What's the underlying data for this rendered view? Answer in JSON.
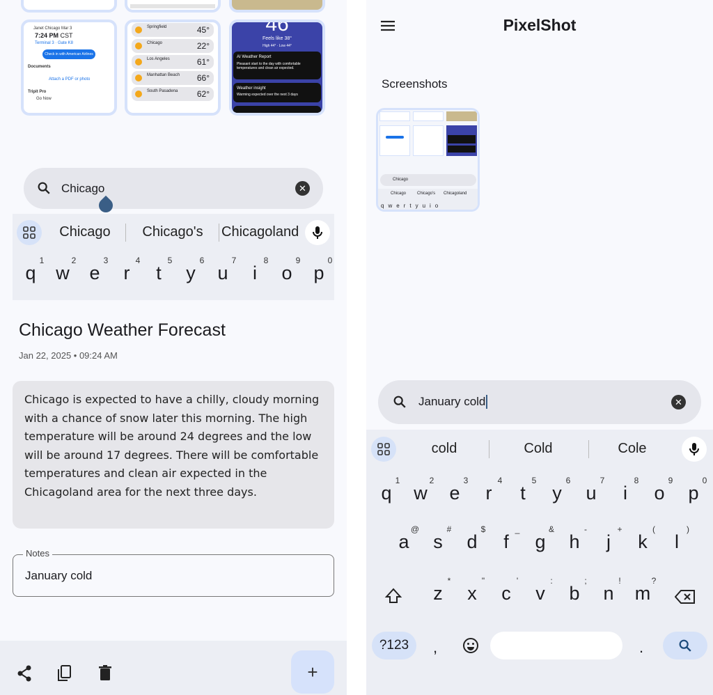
{
  "left": {
    "thumbs": {
      "flight": {
        "date": "Janet Chicago Mar 3",
        "time": "7:24 PM",
        "tz": "CST",
        "terminal": "Terminal 3 · Gate K8",
        "checkin": "Check in with American Airlines",
        "documents": "Documents",
        "attach": "Attach a PDF or photo",
        "trip": "Tripit Pro",
        "go": "Go Now"
      },
      "weather": [
        {
          "city": "Springfield",
          "cond": "Mostly cloudy",
          "temp": "45°"
        },
        {
          "city": "Chicago",
          "cond": "Partly cloudy",
          "temp": "22°"
        },
        {
          "city": "Los Angeles",
          "cond": "Clear",
          "temp": "61°"
        },
        {
          "city": "Manhattan Beach",
          "cond": "Mostly clear",
          "temp": "66°"
        },
        {
          "city": "South Pasadena",
          "cond": "Clear",
          "temp": "62°"
        }
      ],
      "report": {
        "big": "46",
        "feels": "Feels like 38°",
        "hilo": "High 44° · Low 44°",
        "ai_title": "AI Weather Report",
        "ai_text": "Pleasant start to the day with comfortable temperatures and clean air expected.",
        "insight_title": "Weather insight",
        "insight_text": "Warming expected over the next 3 days"
      }
    },
    "search": {
      "value": "Chicago"
    },
    "suggestions": [
      "Chicago",
      "Chicago's",
      "Chicagoland"
    ],
    "keys": [
      [
        "q",
        "1"
      ],
      [
        "w",
        "2"
      ],
      [
        "e",
        "3"
      ],
      [
        "r",
        "4"
      ],
      [
        "t",
        "5"
      ],
      [
        "y",
        "6"
      ],
      [
        "u",
        "7"
      ],
      [
        "i",
        "8"
      ],
      [
        "o",
        "9"
      ],
      [
        "p",
        "0"
      ]
    ],
    "title": "Chicago Weather Forecast",
    "date": "Jan 22, 2025 • 09:24 AM",
    "body": "Chicago is expected to have a chilly, cloudy morning with a chance of snow later this morning. The high temperature will be around 24 degrees and the low will be around 17 degrees. There will be comfortable temperatures and clean air expected in the Chicagoland area for the next three days.",
    "notes_label": "Notes",
    "notes_value": "January cold",
    "fab": "+"
  },
  "right": {
    "app_title": "PixelShot",
    "section": "Screenshots",
    "thumb_search": "Chicago",
    "thumb_suggestions": [
      "Chicago",
      "Chicago's",
      "Chicagoland"
    ],
    "search": {
      "value": "January cold"
    },
    "suggestions": [
      "cold",
      "Cold",
      "Cole"
    ],
    "row1": [
      [
        "q",
        "1"
      ],
      [
        "w",
        "2"
      ],
      [
        "e",
        "3"
      ],
      [
        "r",
        "4"
      ],
      [
        "t",
        "5"
      ],
      [
        "y",
        "6"
      ],
      [
        "u",
        "7"
      ],
      [
        "i",
        "8"
      ],
      [
        "o",
        "9"
      ],
      [
        "p",
        "0"
      ]
    ],
    "row2": [
      [
        "a",
        "@"
      ],
      [
        "s",
        "#"
      ],
      [
        "d",
        "$"
      ],
      [
        "f",
        "_"
      ],
      [
        "g",
        "&"
      ],
      [
        "h",
        "-"
      ],
      [
        "j",
        "+"
      ],
      [
        "k",
        "("
      ],
      [
        "l",
        ")"
      ]
    ],
    "row3": [
      [
        "z",
        "*"
      ],
      [
        "x",
        "\""
      ],
      [
        "c",
        "'"
      ],
      [
        "v",
        ":"
      ],
      [
        "b",
        ";"
      ],
      [
        "n",
        "!"
      ],
      [
        "m",
        "?"
      ]
    ],
    "symbols": "?123",
    "comma": ",",
    "period": "."
  }
}
